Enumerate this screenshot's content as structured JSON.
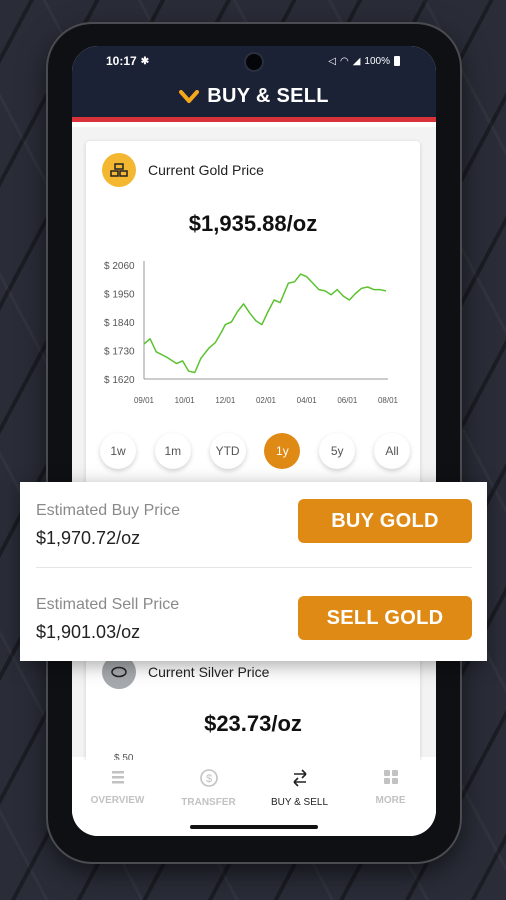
{
  "status_bar": {
    "time": "10:17",
    "battery": "100%"
  },
  "header": {
    "title": "BUY & SELL"
  },
  "gold_card": {
    "title": "Current Gold Price",
    "price": "$1,935.88/oz",
    "ranges": [
      "1w",
      "1m",
      "YTD",
      "1y",
      "5y",
      "All"
    ],
    "active_range": "1y"
  },
  "silver_card": {
    "title": "Current Silver Price",
    "price": "$23.73/oz",
    "y_top_label": "$ 50"
  },
  "trade": {
    "buy_label": "Estimated Buy Price",
    "buy_value": "$1,970.72/oz",
    "buy_button": "BUY GOLD",
    "sell_label": "Estimated Sell Price",
    "sell_value": "$1,901.03/oz",
    "sell_button": "SELL GOLD"
  },
  "nav": {
    "items": [
      {
        "label": "OVERVIEW",
        "icon": "list-icon",
        "active": false
      },
      {
        "label": "TRANSFER",
        "icon": "dollar-circle-icon",
        "active": false
      },
      {
        "label": "BUY & SELL",
        "icon": "swap-arrows-icon",
        "active": true
      },
      {
        "label": "MORE",
        "icon": "grid-icon",
        "active": false
      }
    ]
  },
  "colors": {
    "accent": "#e08a16",
    "header": "#1b2236",
    "header_rule": "#d9323a",
    "line": "#5cc230"
  },
  "chart_data": {
    "type": "line",
    "x_tick_labels": [
      "09/01",
      "10/01",
      "12/01",
      "02/01",
      "04/01",
      "06/01",
      "08/01"
    ],
    "y_tick_labels": [
      "$ 2060",
      "$ 1950",
      "$ 1840",
      "$ 1730",
      "$ 1620"
    ],
    "ylim": [
      1620,
      2060
    ],
    "grid": false,
    "series": [
      {
        "x": [
          0,
          0.15,
          0.3,
          0.55,
          0.8,
          0.95,
          1.1,
          1.25,
          1.4,
          1.6,
          1.75,
          1.9,
          2.0,
          2.15,
          2.3,
          2.45,
          2.6,
          2.75,
          2.9,
          3.05,
          3.2,
          3.35,
          3.55,
          3.7,
          3.85,
          4.0,
          4.15,
          4.3,
          4.45,
          4.6,
          4.75,
          4.9,
          5.05,
          5.2,
          5.35,
          5.5,
          5.65,
          5.8,
          5.95
        ],
        "y": [
          1755,
          1775,
          1725,
          1705,
          1680,
          1690,
          1650,
          1645,
          1700,
          1740,
          1760,
          1800,
          1830,
          1840,
          1880,
          1910,
          1875,
          1845,
          1830,
          1880,
          1925,
          1915,
          1990,
          1995,
          2025,
          2015,
          1990,
          1965,
          1960,
          1945,
          1965,
          1940,
          1925,
          1950,
          1970,
          1975,
          1965,
          1965,
          1960
        ]
      }
    ]
  }
}
